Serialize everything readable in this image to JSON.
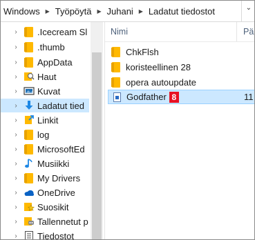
{
  "breadcrumb": {
    "items": [
      "Windows",
      "Työpöytä",
      "Juhani",
      "Ladatut tiedostot"
    ]
  },
  "nav": {
    "items": [
      {
        "label": ".Icecream Sl",
        "icon": "folder-icon"
      },
      {
        "label": ".thumb",
        "icon": "folder-icon"
      },
      {
        "label": "AppData",
        "icon": "folder-icon"
      },
      {
        "label": "Haut",
        "icon": "search-folder-icon"
      },
      {
        "label": "Kuvat",
        "icon": "pictures-icon"
      },
      {
        "label": "Ladatut tied",
        "icon": "downloads-icon",
        "selected": true
      },
      {
        "label": "Linkit",
        "icon": "links-icon"
      },
      {
        "label": "log",
        "icon": "folder-icon"
      },
      {
        "label": "MicrosoftEd",
        "icon": "folder-icon"
      },
      {
        "label": "Musiikki",
        "icon": "music-icon"
      },
      {
        "label": "My Drivers",
        "icon": "folder-icon"
      },
      {
        "label": "OneDrive",
        "icon": "onedrive-icon"
      },
      {
        "label": "Suosikit",
        "icon": "favorites-icon"
      },
      {
        "label": "Tallennetut p",
        "icon": "saved-games-icon"
      },
      {
        "label": "Tiedostot",
        "icon": "documents-icon"
      }
    ]
  },
  "content": {
    "columns": {
      "name": "Nimi",
      "date": "Pä"
    },
    "rows": [
      {
        "name": "ChkFlsh",
        "icon": "folder-icon"
      },
      {
        "name": "koristeellinen 28",
        "icon": "folder-icon"
      },
      {
        "name": "opera autoupdate",
        "icon": "folder-icon"
      },
      {
        "name": "Godfather",
        "icon": "file-icon",
        "badge": "8",
        "size": "11",
        "selected": true
      }
    ]
  },
  "colors": {
    "selection": "#cce8ff",
    "folder": "#ffb900",
    "badge": "#e81123"
  }
}
